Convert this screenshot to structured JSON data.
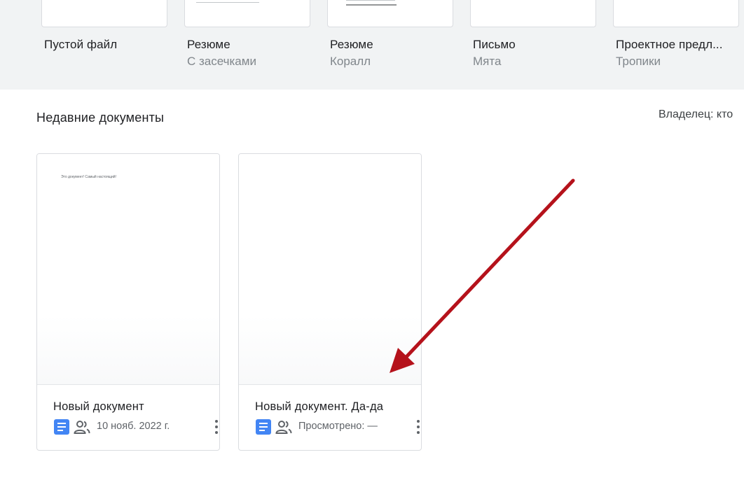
{
  "templates": [
    {
      "name": "Пустой файл",
      "subtitle": ""
    },
    {
      "name": "Резюме",
      "subtitle": "С засечками"
    },
    {
      "name": "Резюме",
      "subtitle": "Коралл"
    },
    {
      "name": "Письмо",
      "subtitle": "Мята"
    },
    {
      "name": "Проектное предл...",
      "subtitle": "Тропики"
    }
  ],
  "recent": {
    "title": "Недавние документы",
    "owner_filter": "Владелец: кто"
  },
  "documents": [
    {
      "title": "Новый документ",
      "preview_text": "Это документ! Самый настоящий!",
      "meta": "10 нояб. 2022 г.",
      "icon": "docs-icon",
      "shared_icon": "shared-people-icon"
    },
    {
      "title": "Новый документ. Да-да",
      "preview_text": "",
      "meta": "Просмотрено: —",
      "icon": "docs-icon",
      "shared_icon": "shared-people-icon"
    }
  ],
  "colors": {
    "band_bg": "#f1f3f4",
    "docs_blue": "#4285f4",
    "annotation_arrow": "#b5121b"
  }
}
